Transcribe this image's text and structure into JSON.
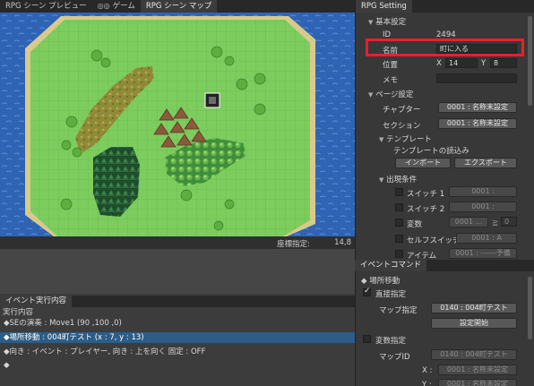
{
  "tabs": [
    {
      "label": "RPG シーン プレビュー",
      "icon": "",
      "active": false
    },
    {
      "label": "ゲーム",
      "icon": "gamepad-icon",
      "active": false
    },
    {
      "label": "RPG シーン マップ",
      "icon": "",
      "active": true
    }
  ],
  "map": {
    "coord_label": "座標指定:",
    "coord_value": "14,8"
  },
  "event_exec": {
    "tab": "イベント実行内容",
    "header": "実行内容",
    "rows": [
      "◆SEの演奏 : Move1 (90 ,100 ,0)",
      "◆場所移動 : 004町テスト (x : 7, y : 13)",
      "◆向き : イベント : プレイヤー, 向き : 上を向く 固定 : OFF",
      "◆"
    ],
    "selected_index": 1
  },
  "inspector": {
    "tab": "RPG Setting",
    "basic_section": "基本設定",
    "id_label": "ID",
    "id_value": "2494",
    "name_label": "名前",
    "name_value": "町に入る",
    "pos_label": "位置",
    "pos_x_label": "X",
    "pos_x": "14",
    "pos_y_label": "Y",
    "pos_y": "8",
    "memo_label": "メモ",
    "memo_value": "",
    "page_section": "ページ設定",
    "chapter_label": "チャプター",
    "chapter_value": "0001 : 名称未設定",
    "section_label": "セクション",
    "section_value": "0001 : 名称未設定",
    "template_section": "テンプレート",
    "template_load": "テンプレートの読込み",
    "import_btn": "インポート",
    "export_btn": "エクスポート",
    "cond_section": "出現条件",
    "switch1_label": "スイッチ 1",
    "switch1_value": "0001 :",
    "switch2_label": "スイッチ 2",
    "switch2_value": "0001 :",
    "var_label": "変数",
    "var_value": "0001 ...",
    "var_op": "≧",
    "var_num": "0",
    "self_switch_label": "セルフスイッチ",
    "self_switch_value": "0001 : A",
    "item_label": "アイテム",
    "item_value": "0001 : ------予備"
  },
  "event_command": {
    "tab": "イベントコマンド",
    "title": "場所移動",
    "direct_label": "直接指定",
    "map_spec_label": "マップ指定",
    "map_spec_value": "0140 : 004町テスト",
    "start_btn": "設定開始",
    "var_spec_label": "変数指定",
    "map_id_label": "マップID",
    "map_id_value": "0140 : 004町テスト",
    "x_label": "X :",
    "x_value": "0001 : 名称未設定",
    "y_label": "Y :",
    "y_value": "0001 : 名称未設定"
  }
}
